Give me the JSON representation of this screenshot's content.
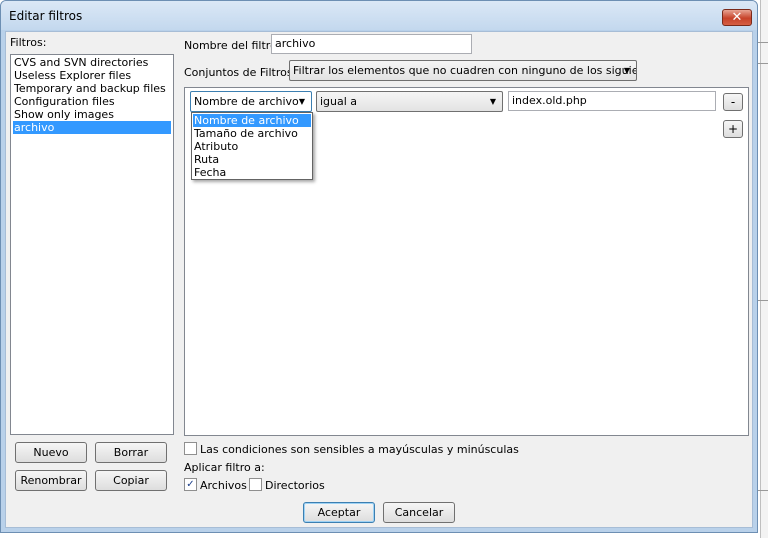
{
  "window": {
    "title": "Editar filtros",
    "close_glyph": "✕"
  },
  "filters": {
    "label": "Filtros:",
    "items": [
      "CVS and SVN directories",
      "Useless Explorer files",
      "Temporary and backup files",
      "Configuration files",
      "Show only images",
      "archivo"
    ],
    "selected_index": 5
  },
  "left_buttons": {
    "new": "Nuevo",
    "delete": "Borrar",
    "rename": "Renombrar",
    "copy": "Copiar"
  },
  "filter_name": {
    "label": "Nombre del filtro:",
    "value": "archivo"
  },
  "filter_sets": {
    "label": "Conjuntos de Filtros:",
    "value": "Filtrar los elementos que no cuadren con ninguno de los siguientes"
  },
  "rule": {
    "type_value": "Nombre de archivo",
    "condition_value": "igual a",
    "text_value": "index.old.php",
    "remove_label": "-",
    "add_label": "+"
  },
  "type_dropdown": {
    "options": [
      "Nombre de archivo",
      "Tamaño de archivo",
      "Atributo",
      "Ruta",
      "Fecha"
    ],
    "highlighted_index": 0
  },
  "options": {
    "case_sensitive_label": "Las condiciones son sensibles a mayúsculas y minúsculas",
    "case_sensitive_checked": false,
    "apply_to_label": "Aplicar filtro a:",
    "files_label": "Archivos",
    "files_checked": true,
    "dirs_label": "Directorios",
    "dirs_checked": false
  },
  "footer": {
    "accept": "Aceptar",
    "cancel": "Cancelar"
  },
  "icons": {
    "dropdown_arrow": "▼",
    "checkmark": "✓"
  },
  "colors": {
    "selection": "#3399ff",
    "dialog_frame": "#b9d1ea",
    "close_button": "#c7422a"
  }
}
